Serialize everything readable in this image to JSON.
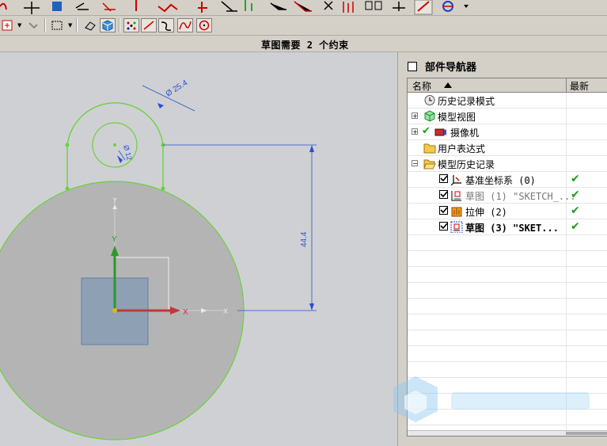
{
  "status_text": "草图需要 2 个约束",
  "navigator": {
    "title": "部件导航器",
    "col_name": "名称",
    "col_latest": "最新",
    "rows": [
      {
        "label": "历史记录模式",
        "icon": "clock-icon",
        "latest": ""
      },
      {
        "label": "模型视图",
        "icon": "model-view-icon",
        "latest": ""
      },
      {
        "label": "摄像机",
        "icon": "camera-icon",
        "latest": ""
      },
      {
        "label": "用户表达式",
        "icon": "folder-icon",
        "latest": ""
      },
      {
        "label": "模型历史记录",
        "icon": "folder-open-icon",
        "latest": ""
      },
      {
        "label": "基准坐标系 (0)",
        "icon": "datum-csys-icon",
        "latest": "✔"
      },
      {
        "label": "草图 (1) \"SKETCH_...",
        "icon": "sketch-icon",
        "latest": "✔"
      },
      {
        "label": "拉伸 (2)",
        "icon": "extrude-icon",
        "latest": "✔"
      },
      {
        "label": "草图 (3) \"SKET...",
        "icon": "sketch-icon",
        "latest": "✔"
      }
    ]
  },
  "sketch": {
    "dim_outer_diameter": "Ø 25.4",
    "dim_inner": "Ø 12",
    "dim_height": "44.4",
    "axis_x": "X",
    "axis_y": "Y"
  },
  "colors": {
    "sketch_curve": "#6ad23c",
    "dimension": "#2850d0",
    "body": "#b4b4b4",
    "tick": "#1ca01c"
  }
}
